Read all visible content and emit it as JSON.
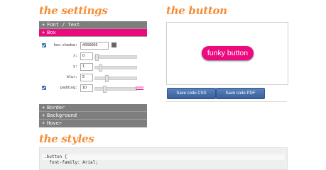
{
  "headings": {
    "settings": "the settings",
    "button": "the button",
    "styles": "the styles"
  },
  "accordion": {
    "font_text": {
      "icon": "+",
      "label": "Font / Text"
    },
    "box": {
      "icon": "+",
      "label": "Box"
    },
    "border": {
      "icon": "+",
      "label": "Border"
    },
    "background": {
      "icon": "+",
      "label": "Background"
    },
    "hover": {
      "icon": "+",
      "label": "Hover"
    }
  },
  "box_settings": {
    "box_shadow": {
      "label": "box-shadow:",
      "value": "#666666",
      "checked": true,
      "swatch_color": "#666666"
    },
    "x": {
      "label": "x:",
      "value": "0",
      "slider_fraction": 0.0
    },
    "y": {
      "label": "y:",
      "value": "1",
      "slider_fraction": 0.1
    },
    "blur": {
      "label": "blur:",
      "value": "5",
      "slider_fraction": 0.25
    },
    "padding": {
      "label": "padding:",
      "value": "10",
      "checked": true,
      "slider_fraction": 0.2,
      "link": "none"
    }
  },
  "preview": {
    "button_label": "funky button",
    "button_color": "#ec0b7f"
  },
  "actions": {
    "save_css": "Save code CSS",
    "save_pdf": "Save code PDF"
  },
  "code": {
    "lines": [
      ".button {",
      "  font-family: Arial;"
    ]
  },
  "colors": {
    "accent": "#ec0b7f",
    "heading": "#f58d35",
    "action_button": "#3b5f9a"
  }
}
